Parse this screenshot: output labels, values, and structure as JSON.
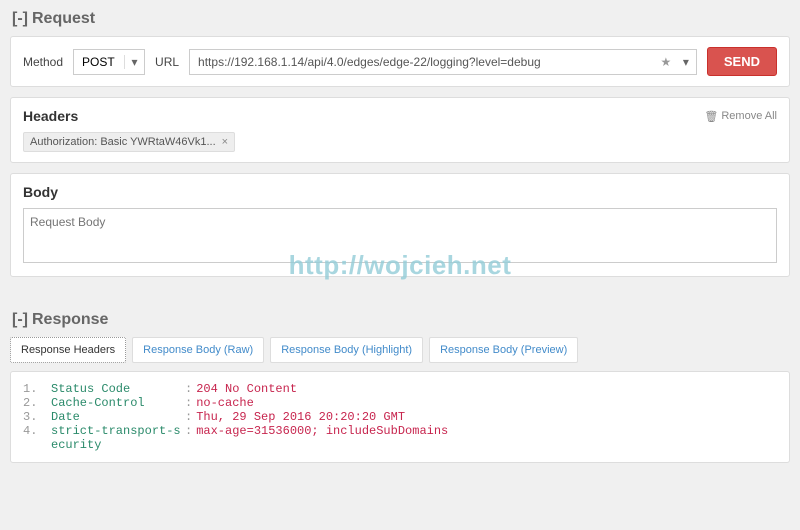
{
  "request": {
    "title": "Request",
    "collapse": "[-]",
    "method_label": "Method",
    "method_value": "POST",
    "url_label": "URL",
    "url_value": "https://192.168.1.14/api/4.0/edges/edge-22/logging?level=debug",
    "send_label": "SEND"
  },
  "headers": {
    "title": "Headers",
    "remove_all": "Remove All",
    "tag": "Authorization: Basic YWRtaW46Vk1...",
    "tag_x": "×"
  },
  "body": {
    "title": "Body",
    "placeholder": "Request Body"
  },
  "watermark": "http://wojcieh.net",
  "response": {
    "title": "Response",
    "collapse": "[-]",
    "tabs": {
      "headers": "Response Headers",
      "raw": "Response Body (Raw)",
      "highlight": "Response Body (Highlight)",
      "preview": "Response Body (Preview)"
    },
    "lines": [
      {
        "n": "1.",
        "key": "Status Code",
        "val": "204 No Content"
      },
      {
        "n": "2.",
        "key": "Cache-Control",
        "val": "no-cache"
      },
      {
        "n": "3.",
        "key": "Date",
        "val": "Thu, 29 Sep 2016 20:20:20 GMT"
      },
      {
        "n": "4.",
        "key": "strict-transport-s",
        "val": "max-age=31536000; includeSubDomains"
      },
      {
        "n": "",
        "key": "ecurity",
        "val": ""
      }
    ]
  }
}
